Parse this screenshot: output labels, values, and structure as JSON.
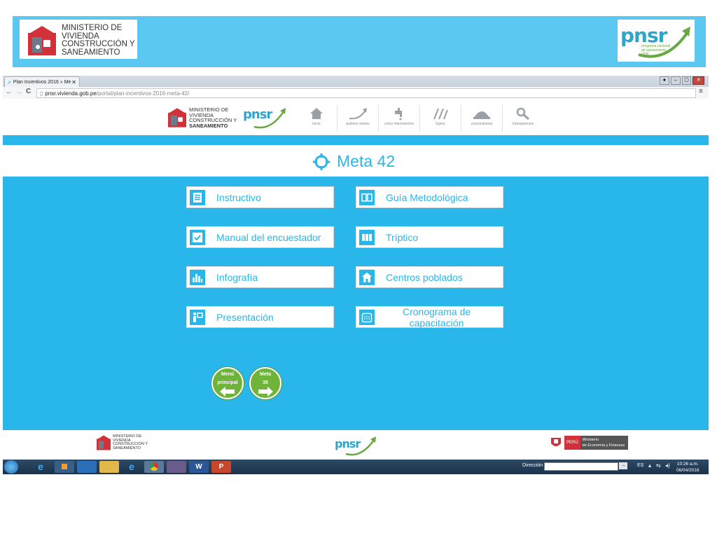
{
  "banner": {
    "ministry": [
      "MINISTERIO DE",
      "VIVIENDA",
      "CONSTRUCCIÓN Y",
      "SANEAMIENTO"
    ],
    "pnsr_word": "pnsr",
    "pnsr_sub": [
      "programa nacional",
      "de saneamiento",
      "rural"
    ]
  },
  "browser": {
    "tab_title": "Plan Incentivos 2016 » Me",
    "url": "pnsr.vivienda.gob.pe/portal/plan-incentivos-2016-meta-42/",
    "url_prefix": "pnsr.vivienda.gob.pe",
    "url_path": "/portal/plan-incentivos-2016-meta-42/"
  },
  "site": {
    "nav": [
      {
        "label": "inicio",
        "icon": "home-icon"
      },
      {
        "label": "quiénes somos",
        "icon": "arrow-curve-icon"
      },
      {
        "label": "cómo intervenimos",
        "icon": "faucet-icon"
      },
      {
        "label": "logros",
        "icon": "arrows-up-icon"
      },
      {
        "label": "convocatorias",
        "icon": "helmet-icon"
      },
      {
        "label": "transparencia",
        "icon": "magnifier-icon"
      }
    ],
    "page_title": "Meta 42"
  },
  "cards": {
    "left": [
      {
        "label": "Instructivo",
        "icon": "document-icon"
      },
      {
        "label": "Manual del encuestador",
        "icon": "checkbox-icon"
      },
      {
        "label": "Infografía",
        "icon": "bar-chart-icon"
      },
      {
        "label": "Presentación",
        "icon": "presenter-icon"
      }
    ],
    "right": [
      {
        "label": "Guía Metodológica",
        "icon": "book-icon"
      },
      {
        "label": "Tríptico",
        "icon": "brochure-icon"
      },
      {
        "label": "Centros poblados",
        "icon": "house-icon"
      },
      {
        "label_line1": "Cronograma de",
        "label_line2": "capacitación",
        "icon": "calendar-icon"
      }
    ]
  },
  "buttons": {
    "menu_line1": "Menú",
    "menu_line2": "principal",
    "meta_line1": "Meta",
    "meta_line2": "35"
  },
  "footer": {
    "ministry": [
      "MINISTERIO DE",
      "VIVIENDA",
      "CONSTRUCCIÓN Y",
      "SANEAMIENTO"
    ],
    "pnsr_word": "pnsr",
    "peru": "PERÚ",
    "mef": [
      "Ministerio",
      "de Economía y Finanzas"
    ]
  },
  "taskbar": {
    "address_label": "Dirección",
    "lang": "ES",
    "time": "10:26 a.m.",
    "date": "06/04/2016"
  },
  "colors": {
    "banner": "#5bc8f2",
    "main_bg": "#29b6ea",
    "green": "#6fb33a",
    "red": "#d3313a"
  }
}
